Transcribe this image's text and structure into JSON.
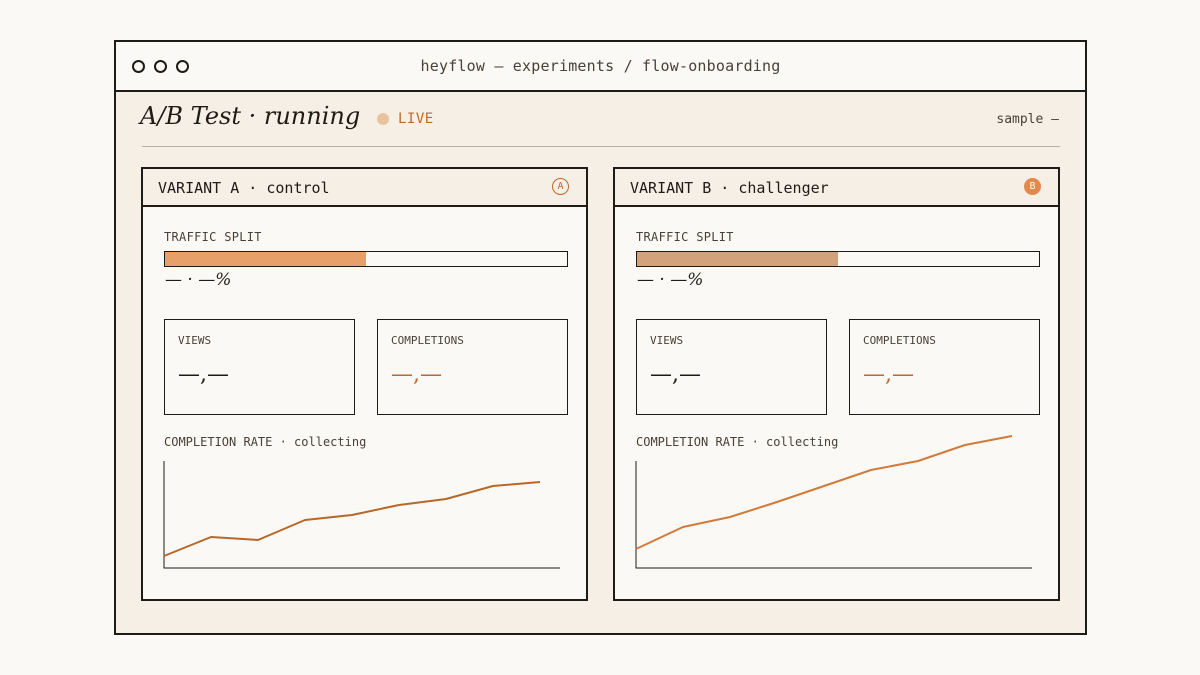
{
  "window": {
    "title": "heyflow — experiments / flow-onboarding"
  },
  "header": {
    "title": "A/B Test · running",
    "status": "LIVE",
    "sample": "sample —"
  },
  "colors": {
    "accent": "#c0682a",
    "fill_a": "#e8a06a",
    "fill_b": "#d2a27c",
    "live_dot": "#e9c3a0",
    "ink": "#1f1b16"
  },
  "variants": [
    {
      "title": "VARIANT A · control",
      "badge": "A",
      "traffic_label": "TRAFFIC SPLIT",
      "traffic_fraction": 0.5,
      "traffic_value": "— · —%",
      "views_label": "VIEWS",
      "views_value": "—,—",
      "completions_label": "COMPLETIONS",
      "completions_value": "—,—",
      "rate_label": "COMPLETION RATE · collecting"
    },
    {
      "title": "VARIANT B · challenger",
      "badge": "B",
      "traffic_label": "TRAFFIC SPLIT",
      "traffic_fraction": 0.5,
      "traffic_value": "— · —%",
      "views_label": "VIEWS",
      "views_value": "—,—",
      "completions_label": "COMPLETIONS",
      "completions_value": "—,—",
      "rate_label": "COMPLETION RATE · collecting"
    }
  ],
  "chart_data": [
    {
      "type": "line",
      "title": "",
      "x": [
        0,
        1,
        2,
        3,
        4,
        5,
        6,
        7,
        8
      ],
      "series": [
        {
          "values": [
            12,
            31,
            28,
            48,
            53,
            63,
            69,
            82,
            86
          ]
        }
      ],
      "ylim": [
        0,
        100
      ],
      "grid": false
    },
    {
      "type": "line",
      "title": "",
      "x": [
        0,
        1,
        2,
        3,
        4,
        5,
        6,
        7,
        8
      ],
      "series": [
        {
          "values": [
            19,
            41,
            51,
            66,
            82,
            98,
            107,
            123,
            132
          ]
        }
      ],
      "ylim": [
        0,
        100
      ],
      "grid": false
    }
  ]
}
